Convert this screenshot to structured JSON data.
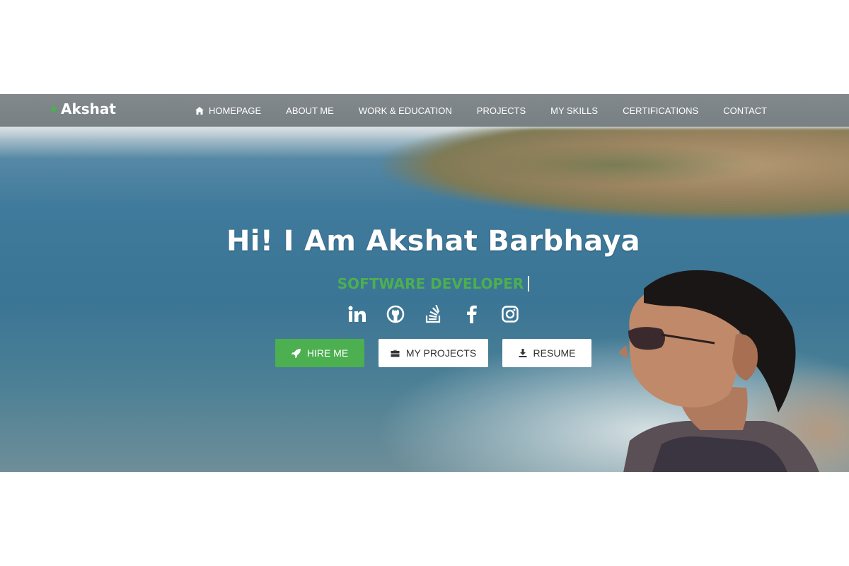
{
  "navbar": {
    "brand": "Akshat",
    "items": [
      {
        "label": "HOMEPAGE",
        "icon": "home-icon"
      },
      {
        "label": "ABOUT ME"
      },
      {
        "label": "WORK & EDUCATION"
      },
      {
        "label": "PROJECTS"
      },
      {
        "label": "MY SKILLS"
      },
      {
        "label": "CERTIFICATIONS"
      },
      {
        "label": "CONTACT"
      }
    ]
  },
  "hero": {
    "title": "Hi! I Am Akshat Barbhaya",
    "subtitle": "SOFTWARE DEVELOPER",
    "socials": [
      "linkedin-icon",
      "github-icon",
      "stackoverflow-icon",
      "facebook-icon",
      "instagram-icon"
    ],
    "buttons": {
      "hire": {
        "label": "HIRE ME",
        "icon": "rocket-icon"
      },
      "projects": {
        "label": "MY PROJECTS",
        "icon": "briefcase-icon"
      },
      "resume": {
        "label": "RESUME",
        "icon": "download-icon"
      }
    }
  },
  "colors": {
    "accent": "#4caf50",
    "navbar": "#6e7376",
    "white": "#ffffff"
  }
}
